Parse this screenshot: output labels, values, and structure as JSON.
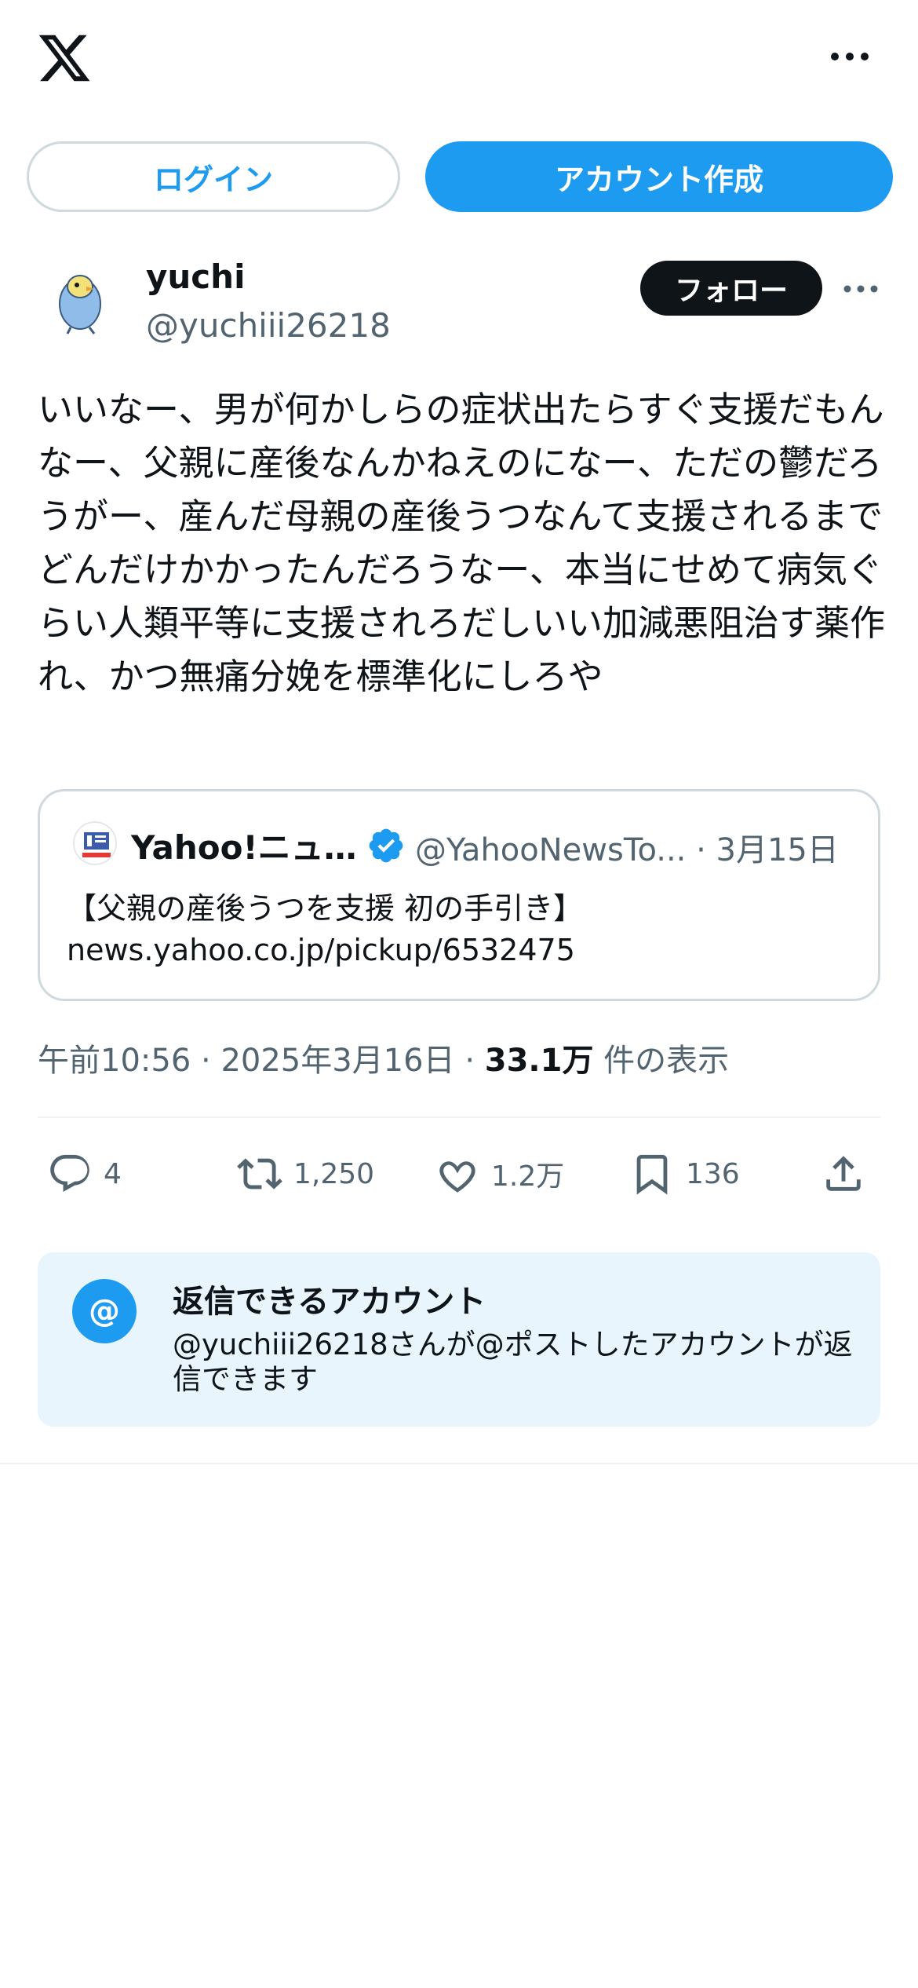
{
  "topbar": {
    "logo_icon": "x-logo-icon",
    "more_icon": "more-horizontal-icon"
  },
  "auth": {
    "login_label": "ログイン",
    "signup_label": "アカウント作成"
  },
  "post": {
    "display_name": "yuchi",
    "handle": "@yuchiii26218",
    "follow_label": "フォロー",
    "text": "いいなー、男が何かしらの症状出たらすぐ支援だもんなー、父親に産後なんかねえのになー、ただの鬱だろうがー、産んだ母親の産後うつなんて支援されるまでどんだけかかったんだろうなー、本当にせめて病気ぐらい人類平等に支援されろだしいい加減悪阻治す薬作れ、かつ無痛分娩を標準化にしろや",
    "time": "午前10:56",
    "date": "2025年3月16日",
    "views_count": "33.1万",
    "views_label": "件の表示",
    "sep": "·"
  },
  "quote": {
    "name": "Yahoo!ニュース",
    "meta": "@YahooNewsTo... · 3月15日",
    "title": "【父親の産後うつを支援 初の手引き】",
    "url": "news.yahoo.co.jp/pickup/6532475"
  },
  "actions": {
    "replies": "4",
    "reposts": "1,250",
    "likes": "1.2万",
    "bookmarks": "136"
  },
  "reply_settings": {
    "title": "返信できるアカウント",
    "description": "@yuchiii26218さんが@ポストしたアカウントが返信できます",
    "icon_text": "@"
  },
  "colors": {
    "accent": "#1d9bf0",
    "text": "#0f1419",
    "muted": "#536471",
    "reply_bg": "#e8f5fd"
  }
}
